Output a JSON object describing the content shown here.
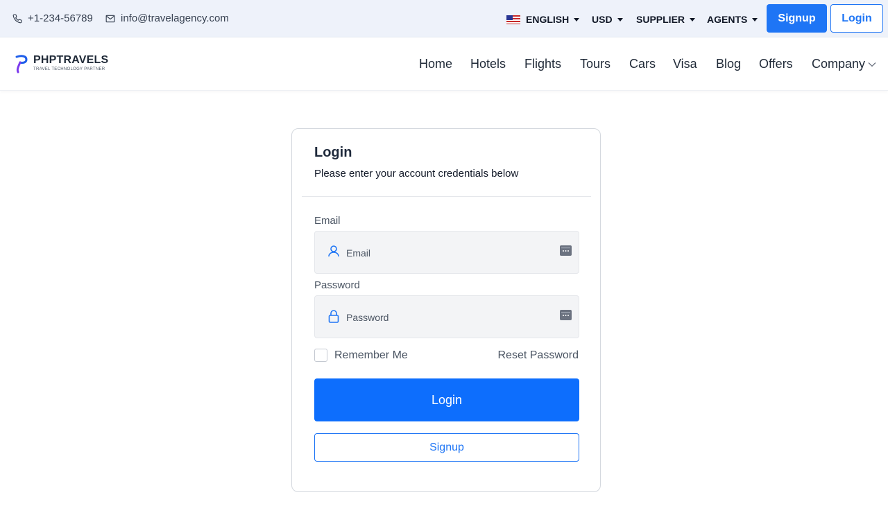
{
  "topbar": {
    "phone": "+1-234-56789",
    "email": "info@travelagency.com",
    "language": "ENGLISH",
    "currency": "USD",
    "supplier": "SUPPLIER",
    "agents": "AGENTS",
    "signup_label": "Signup",
    "login_label": "Login"
  },
  "brand": {
    "name": "PHPTRAVELS",
    "tagline": "TRAVEL TECHNOLOGY PARTNER"
  },
  "nav": {
    "items": [
      "Home",
      "Hotels",
      "Flights",
      "Tours",
      "Cars",
      "Visa",
      "Blog",
      "Offers",
      "Company"
    ]
  },
  "login_card": {
    "title": "Login",
    "subtitle": "Please enter your account credentials below",
    "email_label": "Email",
    "email_placeholder": "Email",
    "password_label": "Password",
    "password_placeholder": "Password",
    "remember_label": "Remember Me",
    "reset_label": "Reset Password",
    "login_button": "Login",
    "signup_button": "Signup"
  },
  "colors": {
    "accent": "#0d6efd",
    "topbar_bg": "#eef2fa"
  },
  "icons": [
    "phone-icon",
    "envelope-icon",
    "us-flag-icon",
    "user-icon",
    "lock-icon",
    "keyboard-icon",
    "chevron-down-icon",
    "brand-logo-icon"
  ]
}
